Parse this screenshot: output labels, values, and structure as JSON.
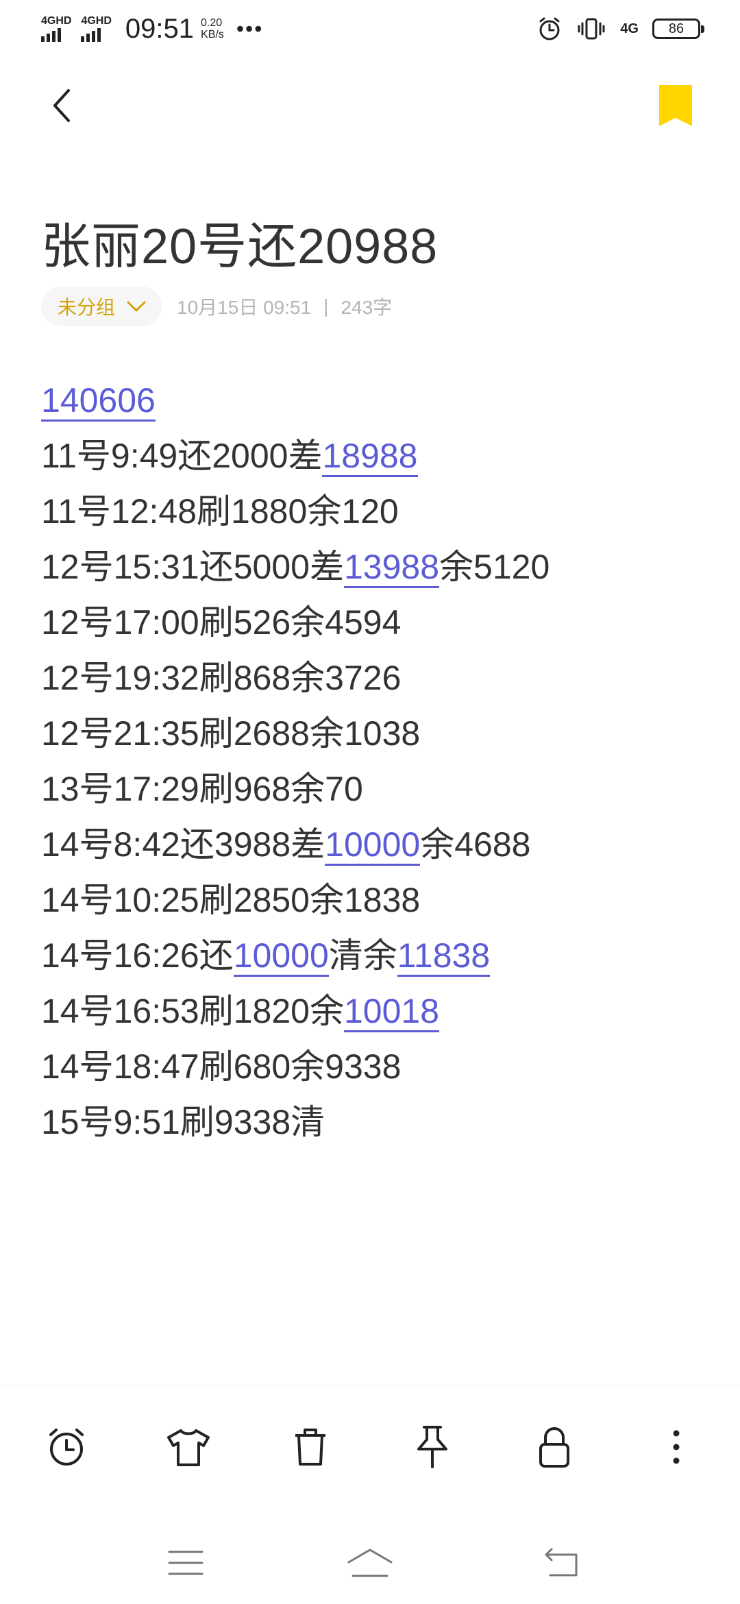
{
  "status_bar": {
    "signal_1": "4GHD",
    "signal_2": "4GHD",
    "time": "09:51",
    "net_speed_value": "0.20",
    "net_speed_unit": "KB/s",
    "more": "•••",
    "network_type": "4G",
    "battery_level": "86",
    "icons": [
      "alarm-icon",
      "vibrate-icon",
      "network-4g-icon",
      "battery-icon"
    ]
  },
  "header": {
    "back_icon": "chevron-left-icon",
    "bookmark_icon": "bookmark-icon",
    "bookmark_color": "#FFD500"
  },
  "note": {
    "title": "张丽20号还20988",
    "group_label": "未分组",
    "date": "10月15日 09:51",
    "separator": "|",
    "word_count": "243字",
    "lines": [
      [
        {
          "t": "140606",
          "link": true
        }
      ],
      [
        {
          "t": "11号9:49还2000差"
        },
        {
          "t": "18988",
          "link": true
        }
      ],
      [
        {
          "t": "11号12:48刷1880余120"
        }
      ],
      [
        {
          "t": "12号15:31还5000差"
        },
        {
          "t": "13988",
          "link": true
        },
        {
          "t": "余5120"
        }
      ],
      [
        {
          "t": "12号17:00刷526余4594"
        }
      ],
      [
        {
          "t": "12号19:32刷868余3726"
        }
      ],
      [
        {
          "t": "12号21:35刷2688余1038"
        }
      ],
      [
        {
          "t": "13号17:29刷968余70"
        }
      ],
      [
        {
          "t": "14号8:42还3988差"
        },
        {
          "t": "10000",
          "link": true
        },
        {
          "t": "余4688"
        }
      ],
      [
        {
          "t": "14号10:25刷2850余1838"
        }
      ],
      [
        {
          "t": "14号16:26还"
        },
        {
          "t": "10000",
          "link": true
        },
        {
          "t": "清余"
        },
        {
          "t": "11838",
          "link": true
        }
      ],
      [
        {
          "t": "14号16:53刷1820余"
        },
        {
          "t": "10018",
          "link": true
        }
      ],
      [
        {
          "t": "14号18:47刷680余9338"
        }
      ],
      [
        {
          "t": "15号9:51刷9338清"
        }
      ]
    ]
  },
  "toolbar": {
    "items": [
      "alarm-clock-icon",
      "shirt-icon",
      "trash-icon",
      "pin-icon",
      "lock-icon",
      "more-vertical-icon"
    ]
  },
  "nav_bar": {
    "items": [
      "menu-icon",
      "home-icon",
      "back-icon"
    ]
  },
  "colors": {
    "accent_yellow": "#FFD500",
    "group_text": "#D4A20A",
    "link": "#5B5BD6",
    "text": "#333333",
    "meta_text": "#B4B4B4"
  }
}
